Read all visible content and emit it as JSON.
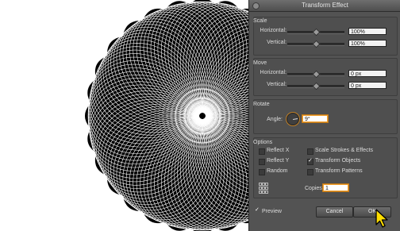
{
  "window": {
    "title": "Transform Effect"
  },
  "scale": {
    "title": "Scale",
    "horizontal_label": "Horizontal:",
    "horizontal_value": "100%",
    "vertical_label": "Vertical:",
    "vertical_value": "100%"
  },
  "move": {
    "title": "Move",
    "horizontal_label": "Horizontal:",
    "horizontal_value": "0 px",
    "vertical_label": "Vertical:",
    "vertical_value": "0 px"
  },
  "rotate": {
    "title": "Rotate",
    "angle_label": "Angle:",
    "angle_value": "9°"
  },
  "options": {
    "title": "Options",
    "reflect_x": {
      "label": "Reflect X",
      "checked": false
    },
    "reflect_y": {
      "label": "Reflect Y",
      "checked": false
    },
    "random": {
      "label": "Random",
      "checked": false
    },
    "scale_strokes": {
      "label": "Scale Strokes & Effects",
      "checked": false
    },
    "transform_objects": {
      "label": "Transform Objects",
      "checked": true
    },
    "transform_patterns": {
      "label": "Transform Patterns",
      "checked": false
    },
    "copies_label": "Copies",
    "copies_value": "1"
  },
  "footer": {
    "preview_label": "Preview",
    "preview_checked": true,
    "cancel_label": "Cancel",
    "ok_label": "OK"
  },
  "colors": {
    "artwork_fill": "#000000",
    "artwork_lines": "#ffffff",
    "dialog_bg": "#535353",
    "focus_ring": "#f0a030"
  }
}
